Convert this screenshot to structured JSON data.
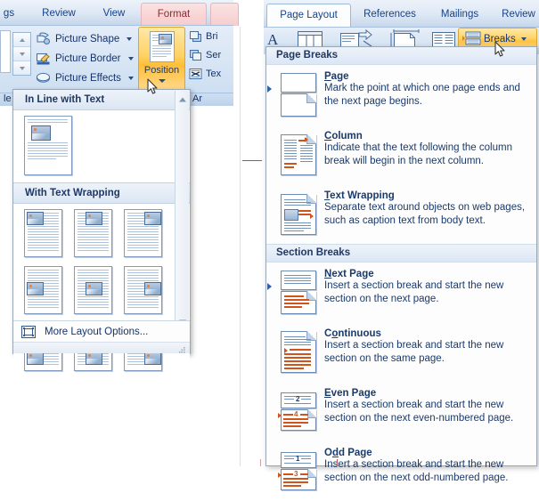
{
  "left": {
    "tabs": [
      {
        "label": "gs",
        "active": false
      },
      {
        "label": "Review",
        "active": false
      },
      {
        "label": "View",
        "active": false
      },
      {
        "label": "Format",
        "active": true
      }
    ],
    "ribbon_commands": [
      {
        "label": "Picture Shape",
        "icon": "picture-shape-icon",
        "has_dropdown": true
      },
      {
        "label": "Picture Border",
        "icon": "picture-border-icon",
        "has_dropdown": true
      },
      {
        "label": "Picture Effects",
        "icon": "picture-effects-icon",
        "has_dropdown": true
      }
    ],
    "position_button": {
      "label": "Position",
      "icon": "position-icon",
      "has_dropdown": true,
      "state": "active",
      "highlight_color": "#ffc241"
    },
    "arrange_commands": [
      {
        "label": "Bri",
        "icon": "bring-to-front-icon"
      },
      {
        "label": "Ser",
        "icon": "send-to-back-icon"
      },
      {
        "label": "Tex",
        "icon": "text-wrapping-icon"
      }
    ],
    "status_left": "le",
    "status_right": "Ar",
    "gallery": {
      "sections": [
        {
          "header": "In Line with Text",
          "thumbnails": [
            {
              "name": "in-line-with-text"
            }
          ]
        },
        {
          "header": "With Text Wrapping",
          "thumbnails": [
            {
              "name": "square-top-left"
            },
            {
              "name": "square-top-center"
            },
            {
              "name": "square-top-right"
            },
            {
              "name": "square-middle-left"
            },
            {
              "name": "square-middle-center"
            },
            {
              "name": "square-middle-right"
            },
            {
              "name": "square-bottom-left"
            },
            {
              "name": "square-bottom-center"
            },
            {
              "name": "square-bottom-right"
            }
          ]
        }
      ],
      "footer": {
        "label": "More Layout Options...",
        "icon": "layout-options-icon"
      },
      "scrollbar": {
        "up": "scroll-up-arrow",
        "down": "scroll-down-arrow"
      }
    }
  },
  "right": {
    "tabs": [
      {
        "label": "Page Layout",
        "active": true
      },
      {
        "label": "References",
        "active": false
      },
      {
        "label": "Mailings",
        "active": false
      },
      {
        "label": "Review",
        "active": false
      }
    ],
    "ribbon_icons": [
      {
        "name": "themes-icon"
      },
      {
        "name": "margins-icon"
      },
      {
        "name": "orientation-icon"
      },
      {
        "name": "size-icon"
      },
      {
        "name": "columns-icon"
      }
    ],
    "breaks_button": {
      "label": "Breaks",
      "icon": "breaks-icon",
      "has_dropdown": true,
      "state": "active",
      "highlight_color": "#ffc241"
    },
    "menu": {
      "groups": [
        {
          "header": "Page Breaks",
          "items": [
            {
              "title": "Page",
              "accel": "P",
              "desc": "Mark the point at which one page ends and the next page begins.",
              "icon": "page-break-icon",
              "selected": true
            },
            {
              "title": "Column",
              "accel": "C",
              "desc": "Indicate that the text following the column break will begin in the next column.",
              "icon": "column-break-icon",
              "selected": false
            },
            {
              "title": "Text Wrapping",
              "accel": "T",
              "desc": "Separate text around objects on web pages, such as caption text from body text.",
              "icon": "text-wrapping-break-icon",
              "selected": false
            }
          ]
        },
        {
          "header": "Section Breaks",
          "items": [
            {
              "title": "Next Page",
              "accel": "N",
              "desc": "Insert a section break and start the new section on the next page.",
              "icon": "next-page-break-icon",
              "selected": true
            },
            {
              "title": "Continuous",
              "accel": "o",
              "desc": "Insert a section break and start the new section on the same page.",
              "icon": "continuous-break-icon",
              "selected": false
            },
            {
              "title": "Even Page",
              "accel": "E",
              "desc": "Insert a section break and start the new section on the next even-numbered page.",
              "icon": "even-page-break-icon",
              "selected": false,
              "page_numbers": [
                "2",
                "4"
              ]
            },
            {
              "title": "Odd Page",
              "accel": "d",
              "desc": "Insert a section break and start the new section on the next odd-numbered page.",
              "icon": "odd-page-break-icon",
              "selected": false,
              "page_numbers": [
                "1",
                "3"
              ]
            }
          ]
        }
      ]
    }
  }
}
